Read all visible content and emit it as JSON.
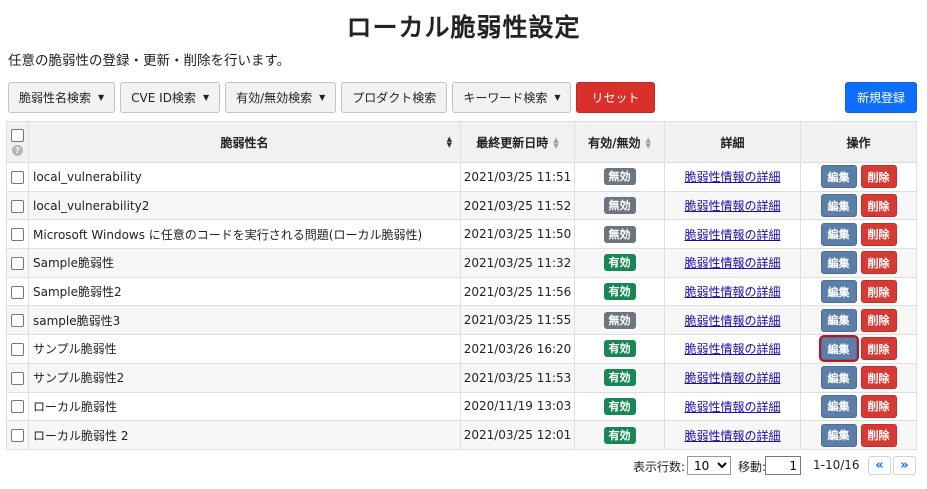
{
  "page": {
    "title": "ローカル脆弱性設定",
    "subtitle": "任意の脆弱性の登録・更新・削除を行います。"
  },
  "toolbar": {
    "filters": [
      {
        "label": "脆弱性名検索",
        "dropdown": true
      },
      {
        "label": "CVE ID検索",
        "dropdown": true
      },
      {
        "label": "有効/無効検索",
        "dropdown": true
      },
      {
        "label": "プロダクト検索",
        "dropdown": false
      },
      {
        "label": "キーワード検索",
        "dropdown": true
      }
    ],
    "reset_label": "リセット",
    "new_label": "新規登録"
  },
  "table": {
    "headers": {
      "name": "脆弱性名",
      "updated": "最終更新日時",
      "status": "有効/無効",
      "detail": "詳細",
      "ops": "操作"
    },
    "help_icon": "?",
    "rows": [
      {
        "name": "local_vulnerability",
        "updated": "2021/03/25 11:51",
        "status": "無効",
        "enabled": false,
        "detail": "脆弱性情報の詳細",
        "edit": "編集",
        "delete": "削除"
      },
      {
        "name": "local_vulnerability2",
        "updated": "2021/03/25 11:52",
        "status": "無効",
        "enabled": false,
        "detail": "脆弱性情報の詳細",
        "edit": "編集",
        "delete": "削除"
      },
      {
        "name": "Microsoft Windows に任意のコードを実行される問題(ローカル脆弱性)",
        "updated": "2021/03/25 11:50",
        "status": "無効",
        "enabled": false,
        "detail": "脆弱性情報の詳細",
        "edit": "編集",
        "delete": "削除"
      },
      {
        "name": "Sample脆弱性",
        "updated": "2021/03/25 11:32",
        "status": "有効",
        "enabled": true,
        "detail": "脆弱性情報の詳細",
        "edit": "編集",
        "delete": "削除"
      },
      {
        "name": "Sample脆弱性2",
        "updated": "2021/03/25 11:56",
        "status": "有効",
        "enabled": true,
        "detail": "脆弱性情報の詳細",
        "edit": "編集",
        "delete": "削除"
      },
      {
        "name": "sample脆弱性3",
        "updated": "2021/03/25 11:55",
        "status": "無効",
        "enabled": false,
        "detail": "脆弱性情報の詳細",
        "edit": "編集",
        "delete": "削除"
      },
      {
        "name": "サンプル脆弱性",
        "updated": "2021/03/26 16:20",
        "status": "有効",
        "enabled": true,
        "detail": "脆弱性情報の詳細",
        "edit": "編集",
        "delete": "削除",
        "focused": true
      },
      {
        "name": "サンプル脆弱性2",
        "updated": "2021/03/25 11:53",
        "status": "有効",
        "enabled": true,
        "detail": "脆弱性情報の詳細",
        "edit": "編集",
        "delete": "削除"
      },
      {
        "name": "ローカル脆弱性",
        "updated": "2020/11/19 13:03",
        "status": "有効",
        "enabled": true,
        "detail": "脆弱性情報の詳細",
        "edit": "編集",
        "delete": "削除"
      },
      {
        "name": "ローカル脆弱性 2",
        "updated": "2021/03/25 12:01",
        "status": "有効",
        "enabled": true,
        "detail": "脆弱性情報の詳細",
        "edit": "編集",
        "delete": "削除"
      }
    ]
  },
  "pager": {
    "rows_label": "表示行数:",
    "rows_value": "10",
    "move_label": "移動:",
    "page_value": "1",
    "range": "1-10/16",
    "prev_icon": "«",
    "next_icon": "»"
  },
  "colors": {
    "reset": "#d9302b",
    "new": "#0d6efd",
    "enabled": "#198754",
    "disabled": "#6c757d",
    "edit": "#5b7fa8",
    "delete": "#d63a34"
  }
}
